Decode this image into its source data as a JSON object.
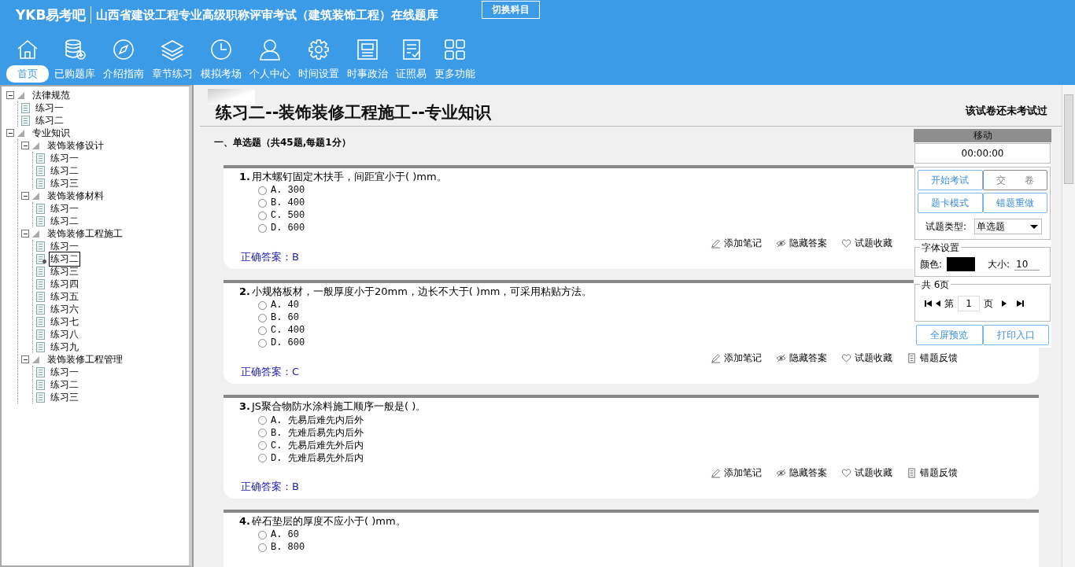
{
  "header": {
    "logo": "YKB易考吧",
    "title": "山西省建设工程专业高级职称评审考试（建筑装饰工程）在线题库",
    "switch_button": "切换科目"
  },
  "nav": [
    {
      "label": "首页",
      "selected": true
    },
    {
      "label": "已购题库",
      "selected": false
    },
    {
      "label": "介绍指南",
      "selected": false
    },
    {
      "label": "章节练习",
      "selected": false
    },
    {
      "label": "模拟考场",
      "selected": false
    },
    {
      "label": "个人中心",
      "selected": false
    },
    {
      "label": "时间设置",
      "selected": false
    },
    {
      "label": "时事政治",
      "selected": false
    },
    {
      "label": "证照易",
      "selected": false
    },
    {
      "label": "更多功能",
      "selected": false
    }
  ],
  "tree": [
    {
      "label": "法律规范",
      "expanded": true,
      "children": [
        {
          "label": "练习一",
          "selected": false
        },
        {
          "label": "练习二",
          "selected": false
        }
      ]
    },
    {
      "label": "专业知识",
      "expanded": true,
      "children": [
        {
          "label": "装饰装修设计",
          "expanded": true,
          "children": [
            {
              "label": "练习一",
              "selected": false
            },
            {
              "label": "练习二",
              "selected": false
            },
            {
              "label": "练习三",
              "selected": false
            }
          ]
        },
        {
          "label": "装饰装修材料",
          "expanded": true,
          "children": [
            {
              "label": "练习一",
              "selected": false
            },
            {
              "label": "练习二",
              "selected": false
            }
          ]
        },
        {
          "label": "装饰装修工程施工",
          "expanded": true,
          "children": [
            {
              "label": "练习一",
              "selected": false
            },
            {
              "label": "练习二",
              "selected": true
            },
            {
              "label": "练习三",
              "selected": false
            },
            {
              "label": "练习四",
              "selected": false
            },
            {
              "label": "练习五",
              "selected": false
            },
            {
              "label": "练习六",
              "selected": false
            },
            {
              "label": "练习七",
              "selected": false
            },
            {
              "label": "练习八",
              "selected": false
            },
            {
              "label": "练习九",
              "selected": false
            }
          ]
        },
        {
          "label": "装饰装修工程管理",
          "expanded": true,
          "children": [
            {
              "label": "练习一",
              "selected": false
            },
            {
              "label": "练习二",
              "selected": false
            },
            {
              "label": "练习三",
              "selected": false
            }
          ]
        }
      ]
    }
  ],
  "paper": {
    "title": "练习二--装饰装修工程施工--专业知识",
    "status": "该试卷还未考试过",
    "section": "一、单选题（共45题,每题1分）"
  },
  "questions": [
    {
      "number": "1.",
      "text": "用木螺钉固定木扶手，间距宜小于( )mm。",
      "options": [
        {
          "label": "A. 300",
          "selected": false
        },
        {
          "label": "B. 400",
          "selected": false
        },
        {
          "label": "C. 500",
          "selected": false
        },
        {
          "label": "D. 600",
          "selected": false
        }
      ],
      "actions": [
        {
          "kind": "note",
          "label": "添加笔记"
        },
        {
          "kind": "hide",
          "label": "隐藏答案"
        },
        {
          "kind": "favorite",
          "label": "试题收藏"
        }
      ],
      "answer": "正确答案：B"
    },
    {
      "number": "2.",
      "text": "小规格板材，一般厚度小于20mm，边长不大于( )mm，可采用粘贴方法。",
      "options": [
        {
          "label": "A. 40",
          "selected": false
        },
        {
          "label": "B. 60",
          "selected": false
        },
        {
          "label": "C. 400",
          "selected": false
        },
        {
          "label": "D. 600",
          "selected": false
        }
      ],
      "actions": [
        {
          "kind": "note",
          "label": "添加笔记"
        },
        {
          "kind": "hide",
          "label": "隐藏答案"
        },
        {
          "kind": "favorite",
          "label": "试题收藏"
        },
        {
          "kind": "feedback",
          "label": "错题反馈"
        }
      ],
      "answer": "正确答案：C"
    },
    {
      "number": "3.",
      "text": "JS聚合物防水涂料施工顺序一般是( )。",
      "options": [
        {
          "label": "A. 先易后难先内后外",
          "selected": false
        },
        {
          "label": "B. 先难后易先内后外",
          "selected": false
        },
        {
          "label": "C. 先易后难先外后内",
          "selected": false
        },
        {
          "label": "D. 先难后易先外后内",
          "selected": false
        }
      ],
      "actions": [
        {
          "kind": "note",
          "label": "添加笔记"
        },
        {
          "kind": "hide",
          "label": "隐藏答案"
        },
        {
          "kind": "favorite",
          "label": "试题收藏"
        },
        {
          "kind": "feedback",
          "label": "错题反馈"
        }
      ],
      "answer": "正确答案：B"
    },
    {
      "number": "4.",
      "text": "碎石垫层的厚度不应小于( )mm。",
      "options": [
        {
          "label": "A. 60",
          "selected": false
        },
        {
          "label": "B. 800",
          "selected": false
        }
      ]
    }
  ],
  "panel": {
    "handle": "移动",
    "timer": "00:00:00",
    "buttons": [
      {
        "label": "开始考试",
        "disabled": false
      },
      {
        "label": "交　　卷",
        "disabled": true
      },
      {
        "label": "题卡模式",
        "disabled": false
      },
      {
        "label": "错题重做",
        "disabled": false
      }
    ],
    "type_label": "试题类型:",
    "type_value": "单选题",
    "font_legend": "字体设置",
    "color_label": "颜色:",
    "size_label": "大小:",
    "size_value": "10",
    "pages_legend": "共 6页",
    "page_prefix": "第",
    "page_value": "1",
    "page_suffix": "页",
    "bottom_buttons": [
      "全屏预览",
      "打印入口"
    ]
  }
}
